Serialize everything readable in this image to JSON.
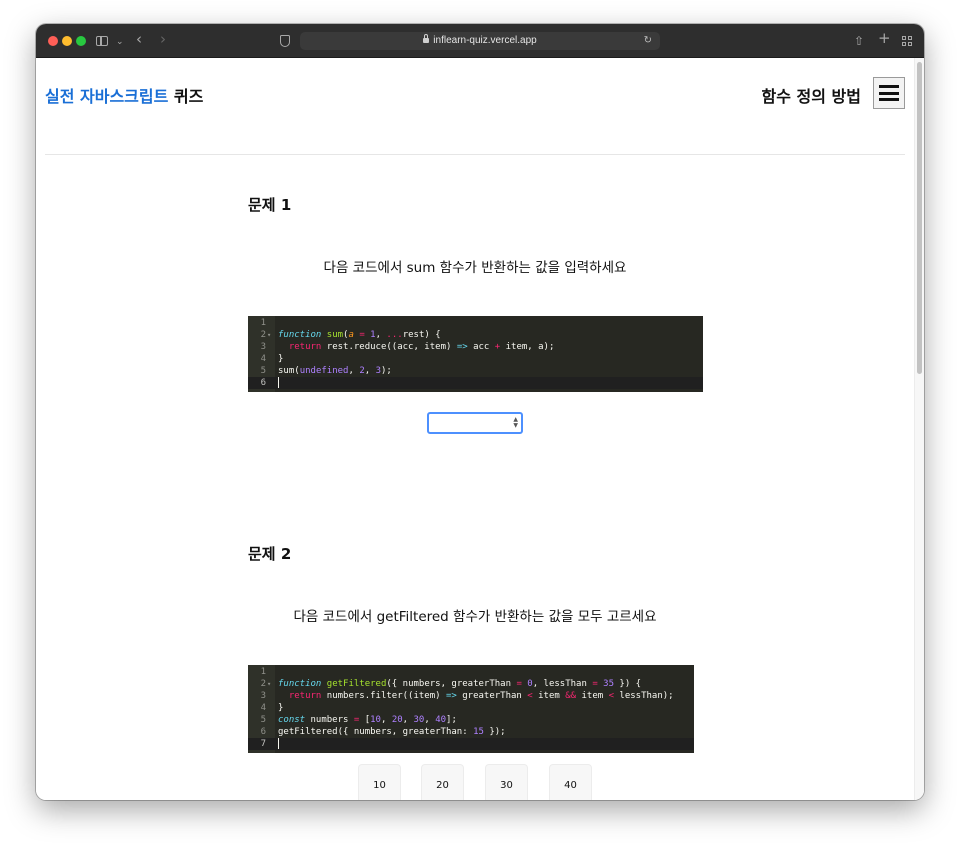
{
  "browser": {
    "url": "inflearn-quiz.vercel.app"
  },
  "header": {
    "title_accent": "실전 자바스크립트",
    "title_rest": " 퀴즈",
    "page_heading": "함수 정의 방법"
  },
  "questions": [
    {
      "title": "문제 1",
      "text": "다음 코드에서 sum 함수가 반환하는 값을 입력하세요",
      "code_lines": [
        "1",
        "2",
        "3",
        "4",
        "5",
        "6"
      ],
      "code": [
        "",
        "function sum(a = 1, ...rest) {",
        "  return rest.reduce((acc, item) => acc + item, a);",
        "}",
        "sum(undefined, 2, 3);",
        ""
      ],
      "answer_value": ""
    },
    {
      "title": "문제 2",
      "text": "다음 코드에서 getFiltered 함수가 반환하는 값을 모두 고르세요",
      "code_lines": [
        "1",
        "2",
        "3",
        "4",
        "5",
        "6",
        "7"
      ],
      "code": [
        "",
        "function getFiltered({ numbers, greaterThan = 0, lessThan = 35 }) {",
        "  return numbers.filter((item) => greaterThan < item && item < lessThan);",
        "}",
        "const numbers = [10, 20, 30, 40];",
        "getFiltered({ numbers, greaterThan: 15 });",
        ""
      ],
      "options": [
        "10",
        "20",
        "30",
        "40"
      ]
    }
  ],
  "colors": {
    "accent": "#1a6fd6",
    "editor_bg": "#272822",
    "input_focus": "#4d90fe"
  }
}
